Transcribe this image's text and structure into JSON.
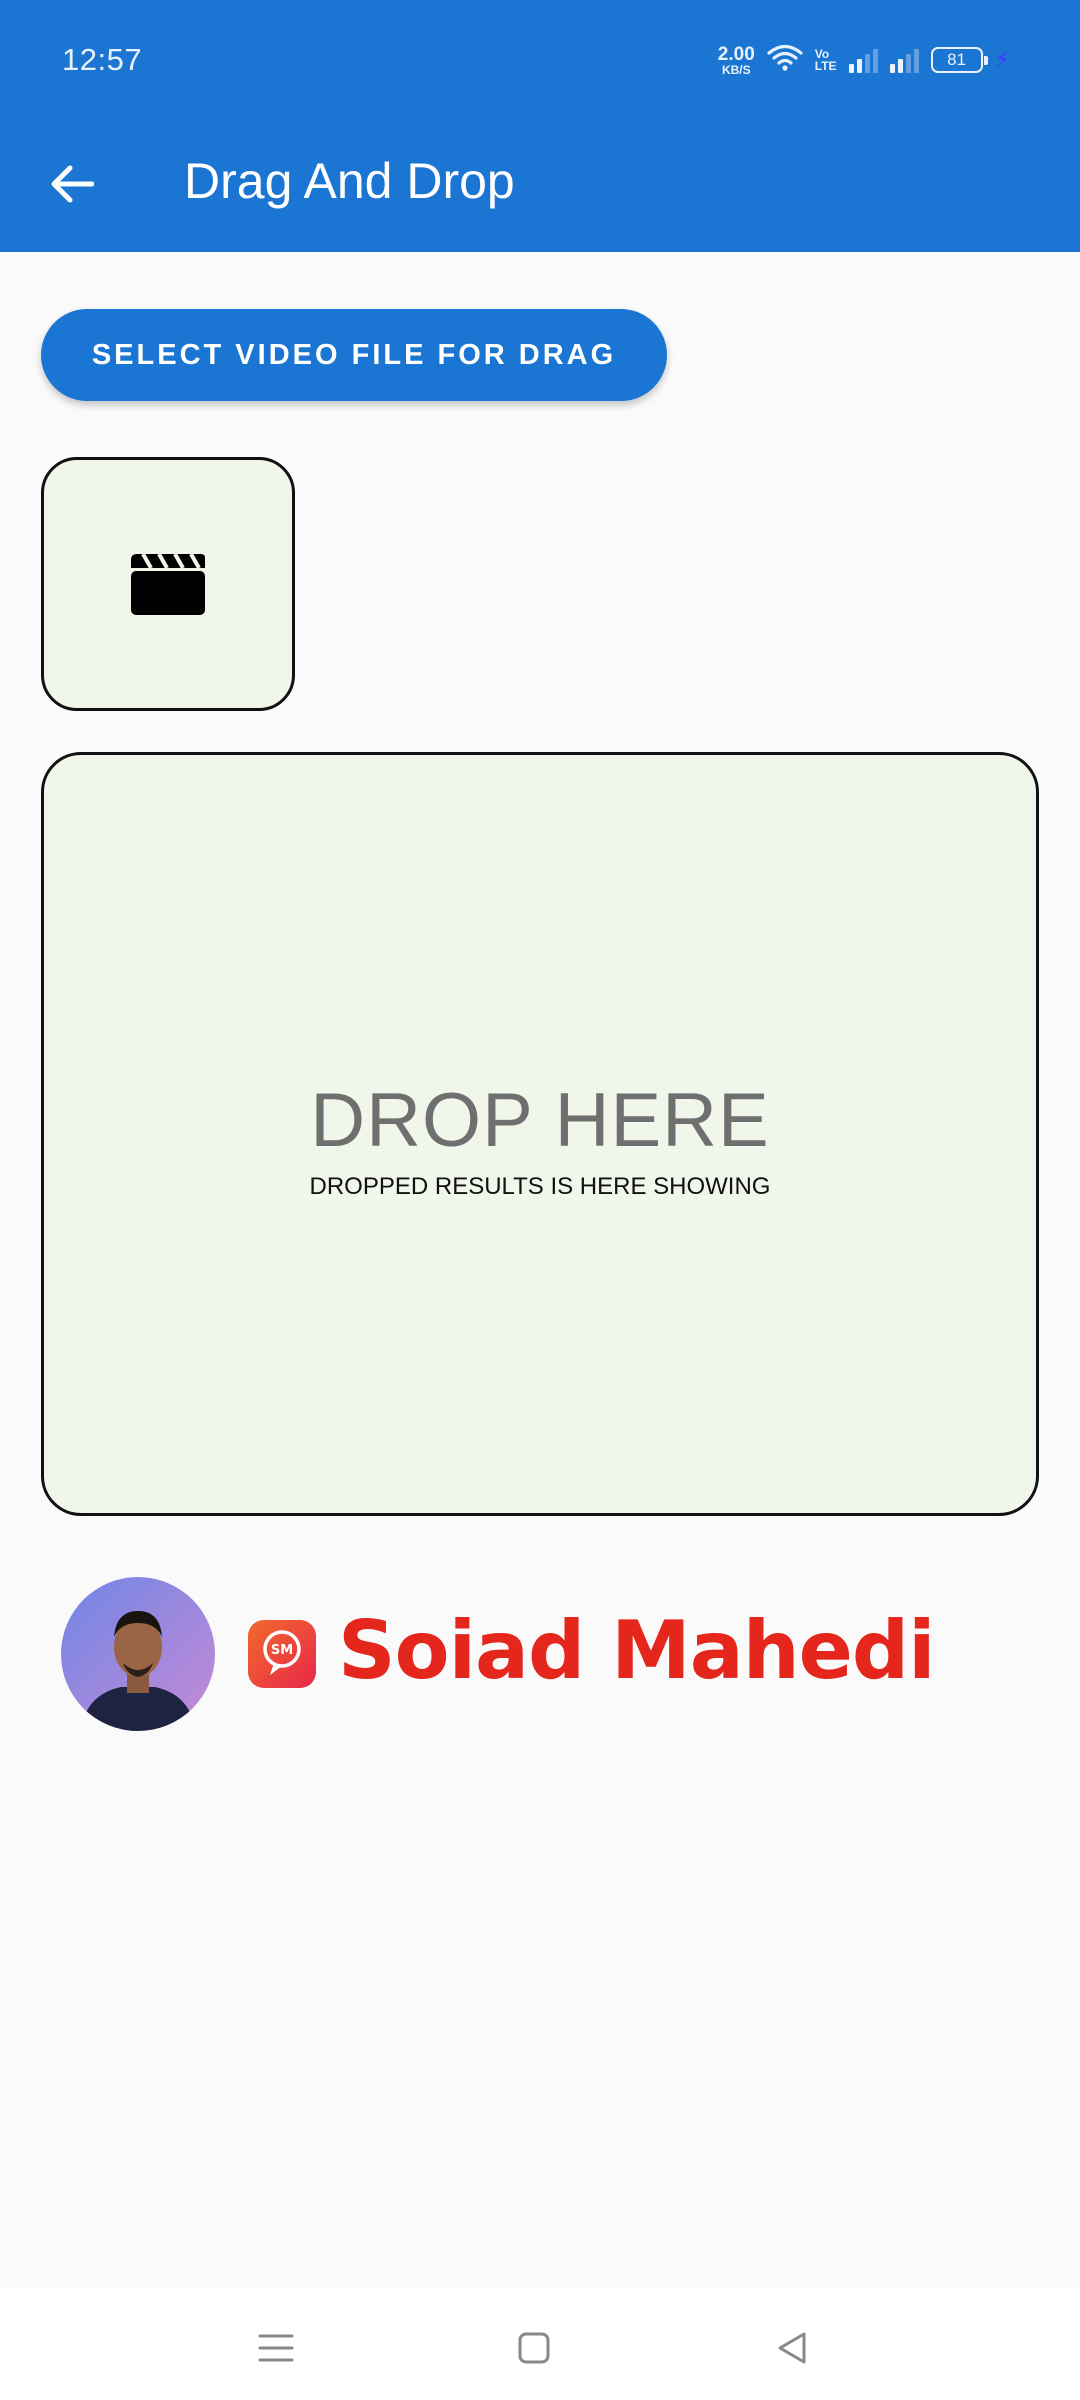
{
  "status_bar": {
    "time": "12:57",
    "net_speed_value": "2.00",
    "net_speed_unit": "KB/S",
    "volte_top": "Vo",
    "volte_bottom": "LTE",
    "battery": "81"
  },
  "app_bar": {
    "title": "Drag And Drop",
    "color": "#1b76d3"
  },
  "select_button": {
    "label": "SELECT VIDEO FILE FOR DRAG"
  },
  "drag_item": {
    "icon": "movie-clapper-icon"
  },
  "drop_zone": {
    "title": "DROP HERE",
    "subtitle": "DROPPED RESULTS IS HERE SHOWING"
  },
  "footer": {
    "author_name": "Soiad Mahedi",
    "logo_text": "SM",
    "brand_color": "#e4261c"
  },
  "nav_bar": {
    "items": [
      "menu-icon",
      "home-icon",
      "back-icon"
    ]
  }
}
